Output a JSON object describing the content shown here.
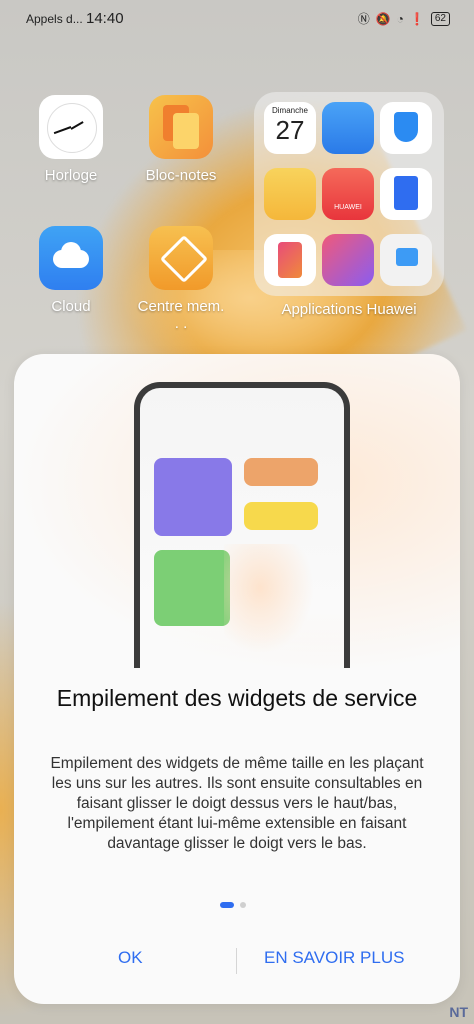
{
  "status_bar": {
    "carrier": "Appels d...",
    "time": "14:40",
    "battery": "62"
  },
  "home": {
    "apps": [
      {
        "label": "Horloge",
        "icon": "clock-icon"
      },
      {
        "label": "Bloc-notes",
        "icon": "notes-icon"
      },
      {
        "label": "Cloud",
        "icon": "cloud-icon"
      },
      {
        "label": "Centre mem. . .",
        "icon": "member-center-icon"
      }
    ],
    "folder": {
      "label": "Applications Huawei",
      "calendar_day_name": "Dimanche",
      "calendar_day": "27",
      "store_label": "HUAWEI"
    }
  },
  "dialog": {
    "title": "Empilement des widgets de service",
    "description": "Empilement des widgets de même taille en les plaçant les uns sur les autres. Ils sont ensuite consultables en faisant glisser le doigt dessus vers le haut/bas, l'empilement étant lui-même extensible en faisant davantage glisser le doigt vers le bas.",
    "ok_label": "OK",
    "more_label": "EN SAVOIR PLUS",
    "page_indicator": {
      "current": 1,
      "total": 2
    }
  },
  "watermark": "NT",
  "colors": {
    "accent": "#2f6df0"
  }
}
